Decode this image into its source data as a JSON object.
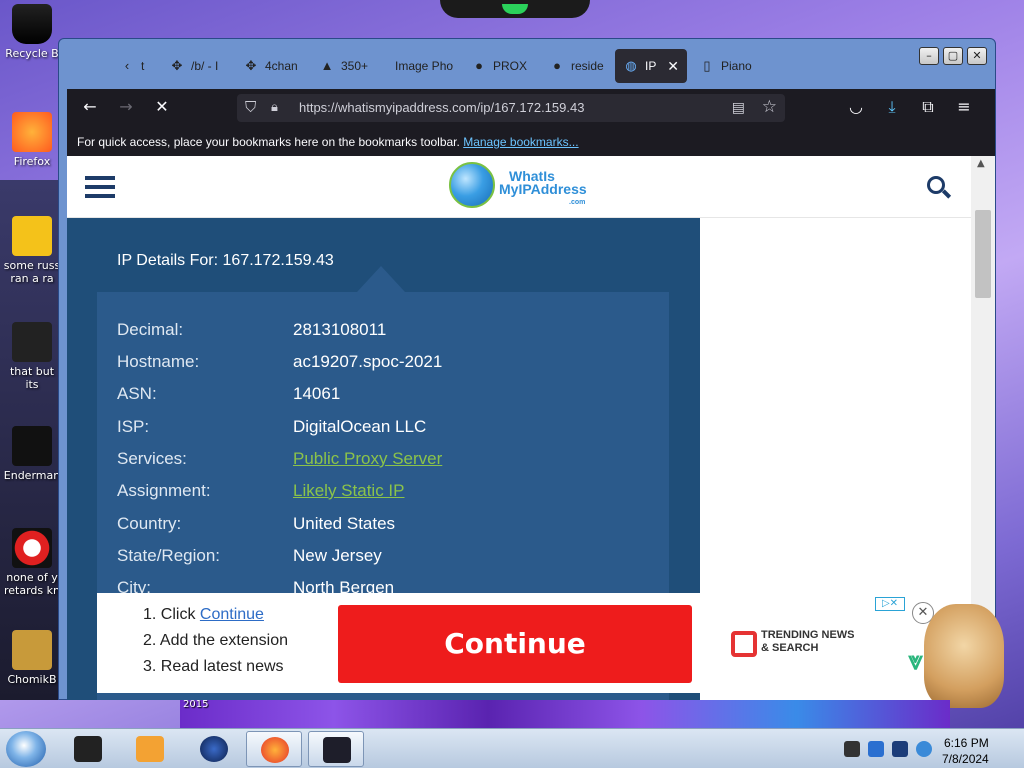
{
  "desktop": {
    "icons": [
      {
        "label": "Recycle B"
      },
      {
        "label": "Firefox"
      },
      {
        "label": "some russ ran a ra"
      },
      {
        "label": "that but its"
      },
      {
        "label": "Enderman"
      },
      {
        "label": "none of y retards kn"
      },
      {
        "label": "ChomikB"
      }
    ],
    "strip_label": "2015"
  },
  "browser": {
    "tabs": [
      {
        "label": "t",
        "icon": "back-arrow-icon"
      },
      {
        "label": "/b/ - I",
        "icon": "clover-icon"
      },
      {
        "label": "4chan",
        "icon": "clover-icon"
      },
      {
        "label": "350+",
        "icon": "image-icon"
      },
      {
        "label": "Image Pho",
        "icon": "blank-icon"
      },
      {
        "label": "PROX",
        "icon": "github-icon"
      },
      {
        "label": "reside",
        "icon": "github-icon"
      },
      {
        "label": "IP",
        "icon": "globe-icon"
      },
      {
        "label": "Piano",
        "icon": "page-icon"
      }
    ],
    "url": "https://whatismyipaddress.com/ip/167.172.159.43",
    "bookmarks_text": "For quick access, place your bookmarks here on the bookmarks toolbar.",
    "bookmarks_link": "Manage bookmarks..."
  },
  "site": {
    "logo_line1": "WhatIs",
    "logo_line2": "MyIPAddress",
    "logo_sub": ".com",
    "heading": "IP Details For: 167.172.159.43",
    "details": [
      {
        "key": "Decimal:",
        "value": "2813108011",
        "link": false
      },
      {
        "key": "Hostname:",
        "value": "ac19207.spoc-2021",
        "link": false
      },
      {
        "key": "ASN:",
        "value": "14061",
        "link": false
      },
      {
        "key": "ISP:",
        "value": "DigitalOcean LLC",
        "link": false
      },
      {
        "key": "Services:",
        "value": "Public Proxy Server",
        "link": true
      },
      {
        "key": "Assignment:",
        "value": "Likely Static IP",
        "link": true
      },
      {
        "key": "Country:",
        "value": "United States",
        "link": false
      },
      {
        "key": "State/Region:",
        "value": "New Jersey",
        "link": false
      },
      {
        "key": "City:",
        "value": "North Bergen",
        "link": false
      }
    ]
  },
  "ad": {
    "step1_prefix": "1. Click ",
    "step1_link": "Continue",
    "step2": "2. Add the extension",
    "step3": "3. Read latest news",
    "button": "Continue",
    "brand_line1": "TRENDING NEWS",
    "brand_line2": "& SEARCH"
  },
  "taskbar": {
    "time": "6:16 PM",
    "date": "7/8/2024"
  }
}
